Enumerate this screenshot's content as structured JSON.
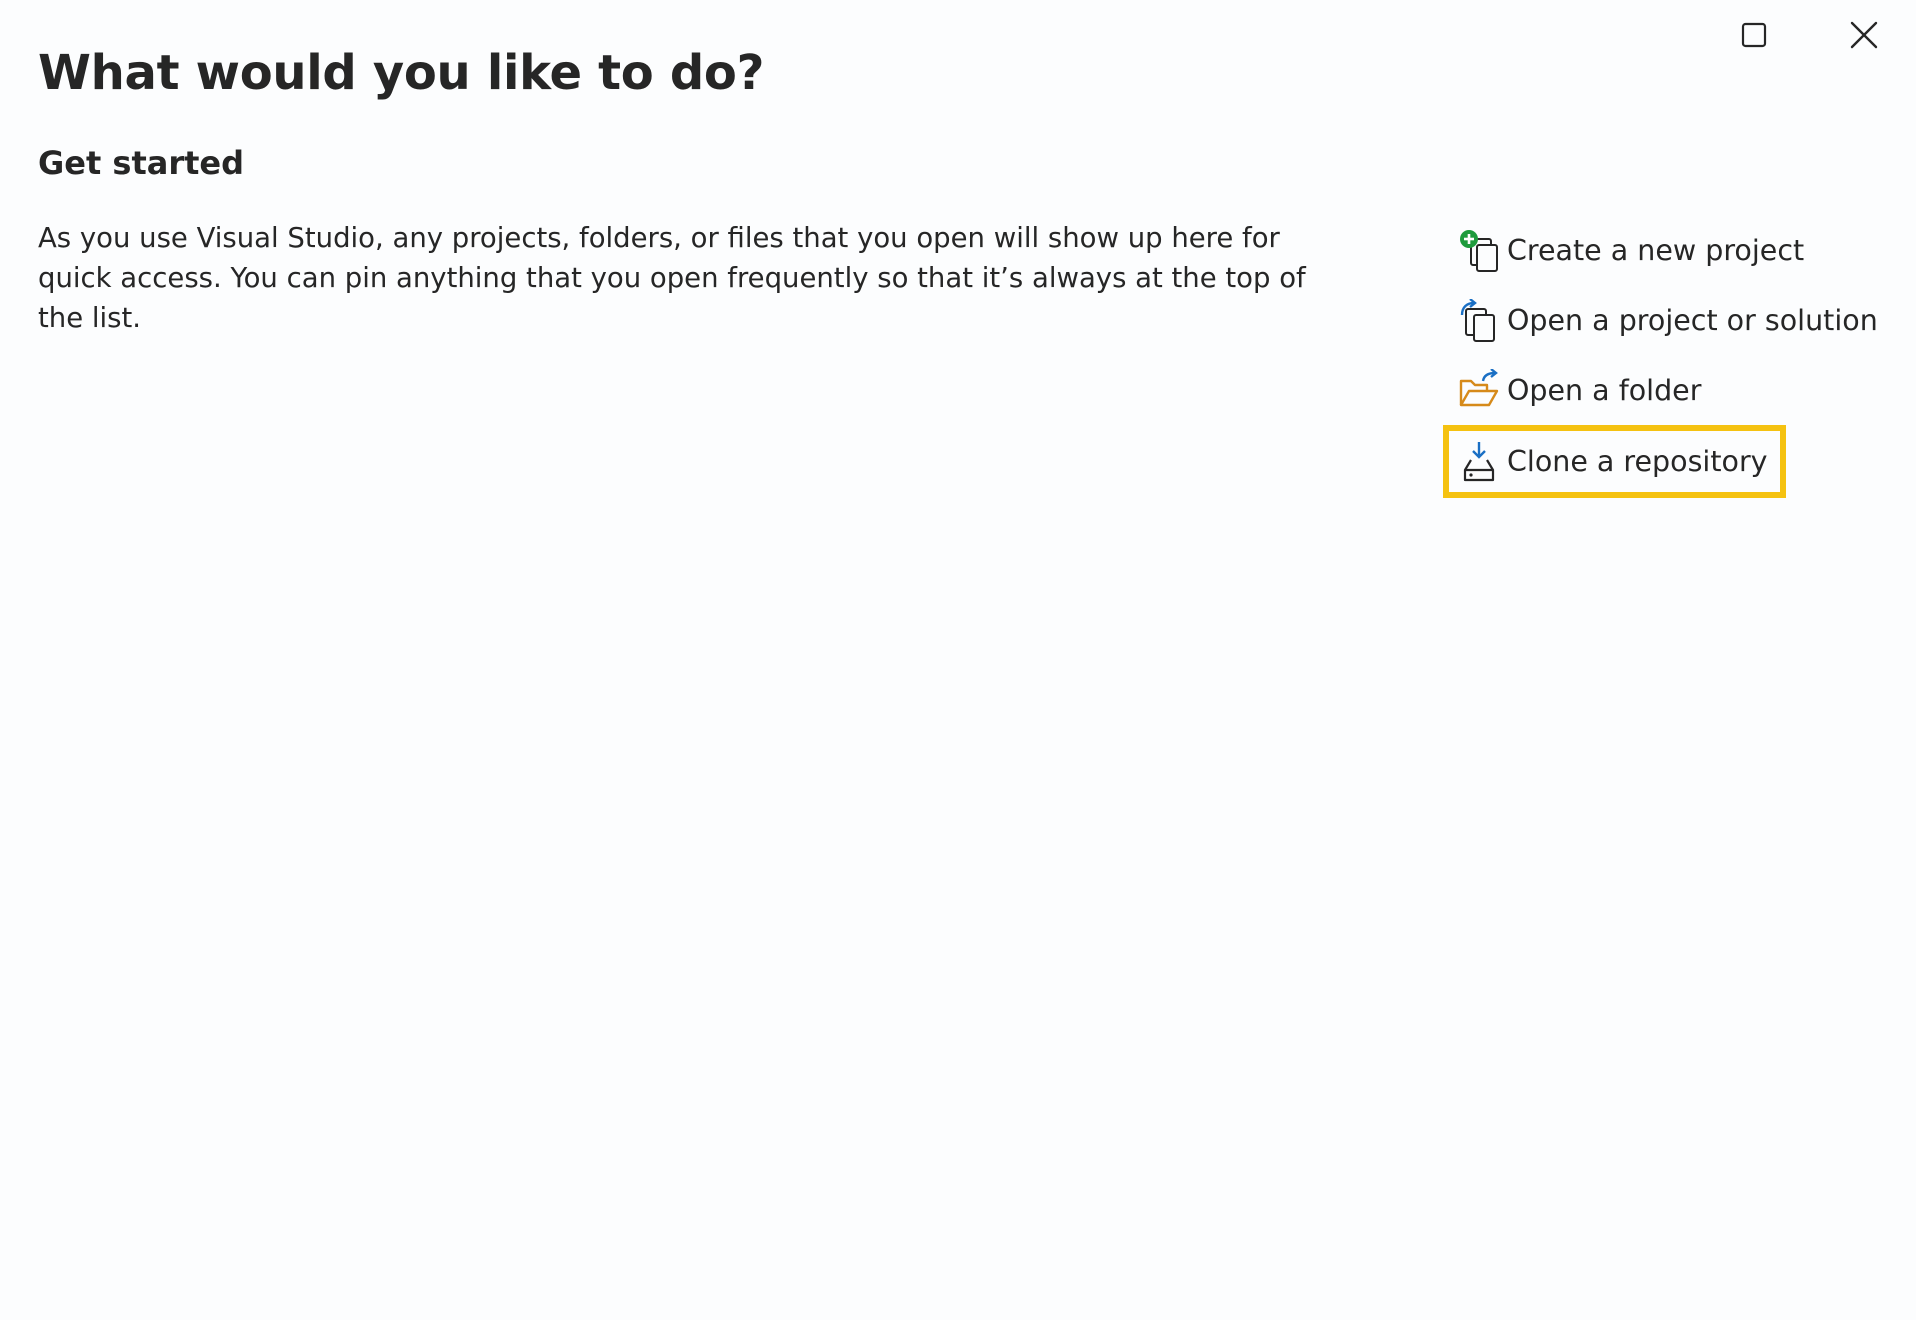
{
  "window": {
    "maximize_icon": "maximize-icon",
    "close_icon": "close-icon"
  },
  "page": {
    "title": "What would you like to do?"
  },
  "get_started": {
    "heading": "Get started",
    "description": "As you use Visual Studio, any projects, folders, or files that you open will show up here for quick access. You can pin anything that you open frequently so that it’s always at the top of the list."
  },
  "actions": [
    {
      "label": "Create a new project",
      "icon": "new-project-icon"
    },
    {
      "label": "Open a project or solution",
      "icon": "open-project-icon"
    },
    {
      "label": "Open a folder",
      "icon": "open-folder-icon"
    },
    {
      "label": "Clone a repository",
      "icon": "clone-repository-icon",
      "highlighted": true
    }
  ],
  "colors": {
    "highlight": "#f5c211",
    "accent_green": "#1e9b3c",
    "accent_blue": "#1a6fc4",
    "folder_orange": "#d68a1a"
  }
}
